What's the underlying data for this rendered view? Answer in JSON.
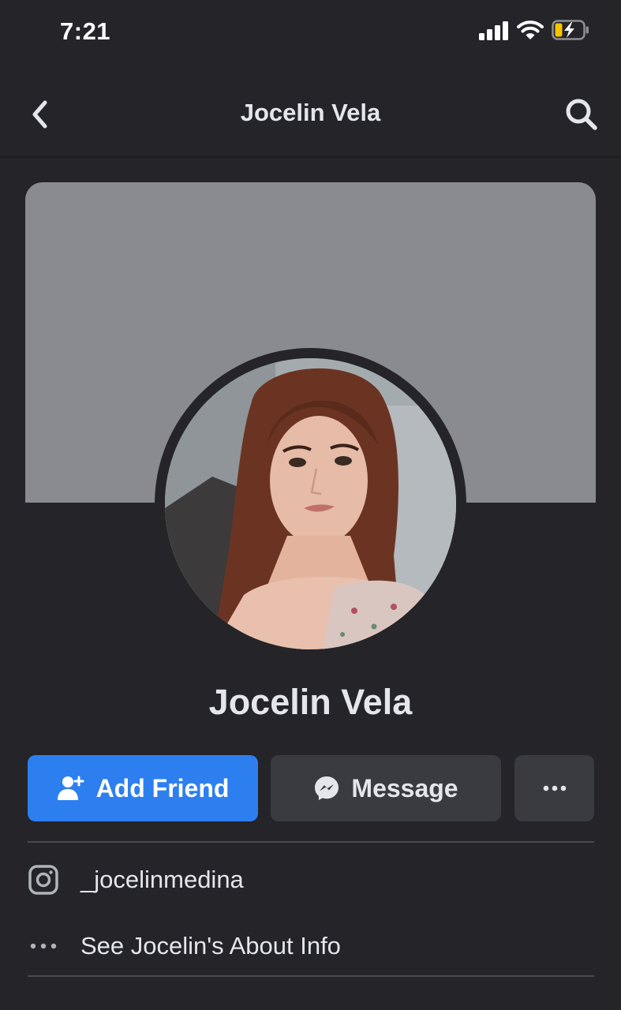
{
  "status_bar": {
    "time": "7:21",
    "icons": [
      "cellular-signal-icon",
      "wifi-icon",
      "battery-charging-icon"
    ],
    "battery_color": "#f5c400"
  },
  "nav": {
    "title": "Jocelin Vela",
    "back_icon": "chevron-left-icon",
    "search_icon": "search-icon"
  },
  "profile": {
    "name": "Jocelin Vela",
    "cover_color": "#8a8b90"
  },
  "actions": {
    "add_friend_label": "Add Friend",
    "add_friend_icon": "add-person-icon",
    "add_friend_color": "#2d7ff0",
    "message_label": "Message",
    "message_icon": "messenger-icon",
    "more_label": "•••",
    "more_icon": "more-dots-icon"
  },
  "info": {
    "instagram_handle": "_jocelinmedina",
    "instagram_icon": "instagram-icon",
    "about_link": "See Jocelin's About Info",
    "about_icon": "more-dots-icon"
  },
  "colors": {
    "background": "#242429",
    "accent": "#2d7ff0"
  }
}
